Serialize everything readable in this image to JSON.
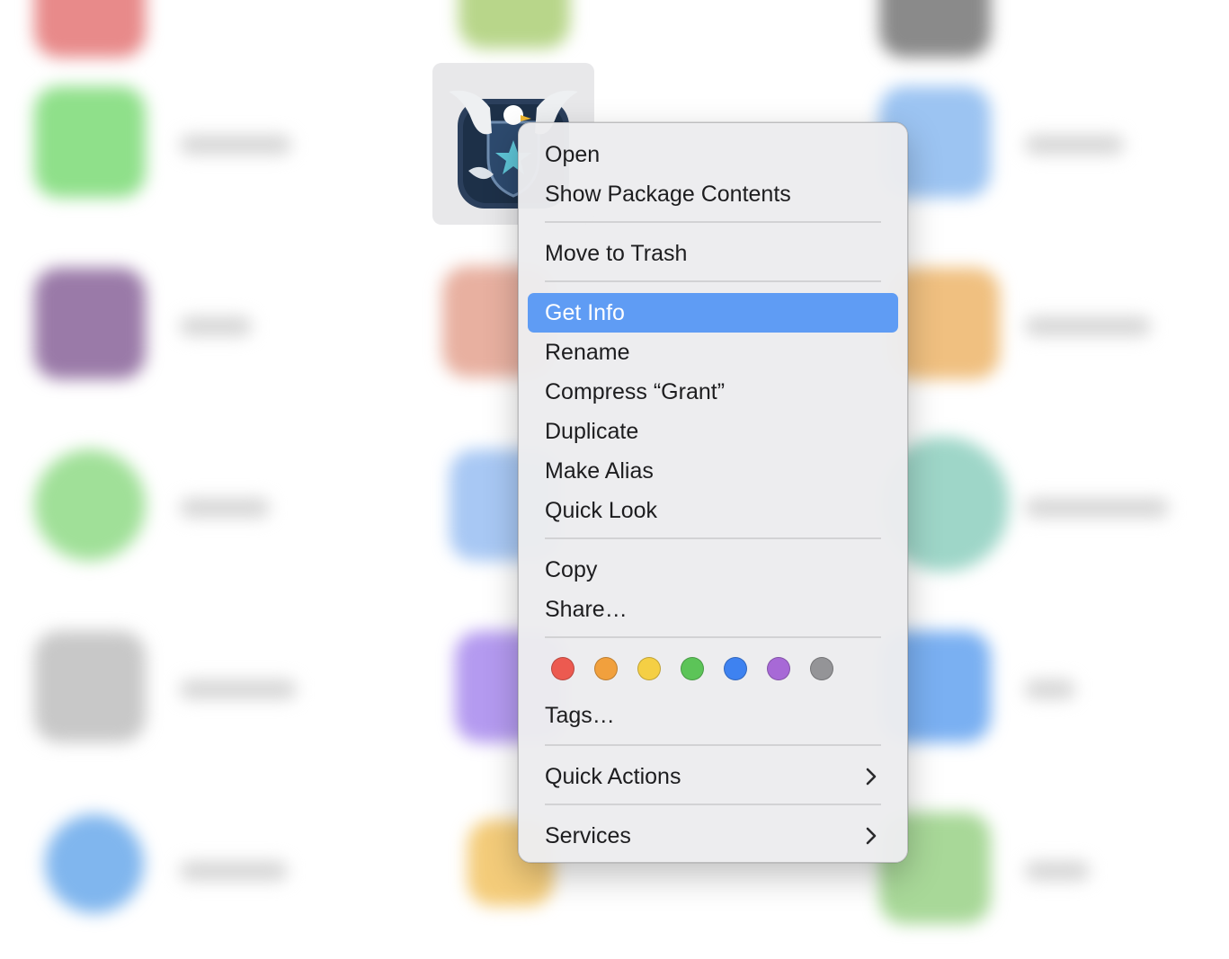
{
  "menu": {
    "items": [
      {
        "label": "Open"
      },
      {
        "label": "Show Package Contents"
      },
      {
        "label": "Move to Trash"
      },
      {
        "label": "Get Info"
      },
      {
        "label": "Rename"
      },
      {
        "label": "Compress “Grant”"
      },
      {
        "label": "Duplicate"
      },
      {
        "label": "Make Alias"
      },
      {
        "label": "Quick Look"
      },
      {
        "label": "Copy"
      },
      {
        "label": "Share…"
      },
      {
        "label": "Tags…"
      },
      {
        "label": "Quick Actions"
      },
      {
        "label": "Services"
      }
    ],
    "highlighted_item": "Get Info",
    "submenu_icon": "chevron-right-icon"
  },
  "tag_colors": [
    {
      "name": "red",
      "color": "#ec5a50"
    },
    {
      "name": "orange",
      "color": "#f1a03d"
    },
    {
      "name": "yellow",
      "color": "#f5cf44"
    },
    {
      "name": "green",
      "color": "#5cc458"
    },
    {
      "name": "blue",
      "color": "#3e82f0"
    },
    {
      "name": "purple",
      "color": "#a769d6"
    },
    {
      "name": "gray",
      "color": "#949497"
    }
  ],
  "selected_app": {
    "icon": "eagle-shield-icon"
  },
  "colors": {
    "highlight": "#5f9cf4",
    "menu_background": "#ececee"
  }
}
